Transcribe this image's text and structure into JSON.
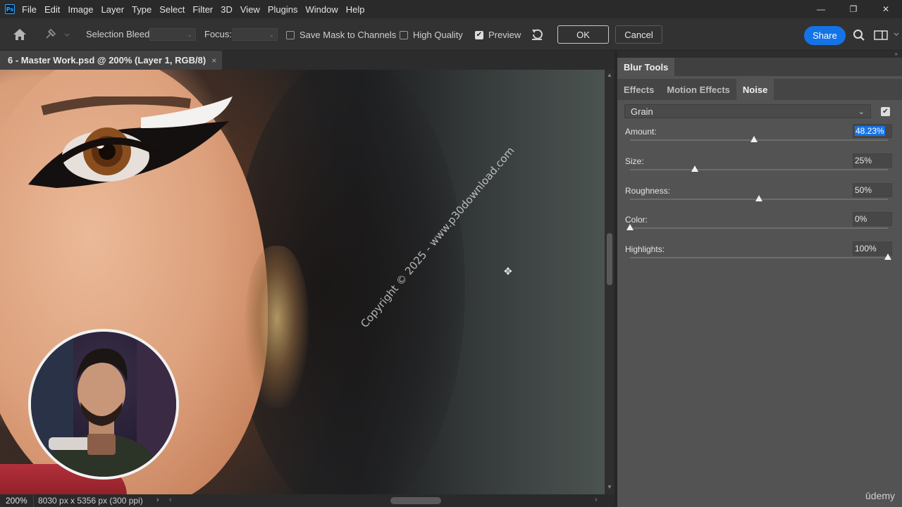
{
  "menubar": {
    "logo": "Ps",
    "items": [
      "File",
      "Edit",
      "Image",
      "Layer",
      "Type",
      "Select",
      "Filter",
      "3D",
      "View",
      "Plugins",
      "Window",
      "Help"
    ],
    "window_controls": [
      "—",
      "❐",
      "✕"
    ]
  },
  "options": {
    "selection_bleed_label": "Selection Bleed:",
    "focus_label": "Focus:",
    "save_mask_label": "Save Mask to Channels",
    "save_mask_checked": false,
    "high_quality_label": "High Quality",
    "high_quality_checked": false,
    "preview_label": "Preview",
    "preview_checked": true,
    "ok_label": "OK",
    "cancel_label": "Cancel",
    "share_label": "Share"
  },
  "document": {
    "tab_title": "6 - Master Work.psd @ 200% (Layer 1, RGB/8)",
    "close_glyph": "×",
    "watermark": "Copyright © 2025 - www.p30download.com"
  },
  "statusbar": {
    "zoom": "200%",
    "info": "8030 px x 5356 px (300 ppi)"
  },
  "panel": {
    "title": "Blur Tools",
    "tabs": [
      "Effects",
      "Motion Effects",
      "Noise"
    ],
    "active_tab": "Noise",
    "preset": "Grain",
    "preset_enabled": true,
    "params": [
      {
        "label": "Amount:",
        "value": "48.23%",
        "level": 0.48
      },
      {
        "label": "Size:",
        "value": "25%",
        "level": 0.25
      },
      {
        "label": "Roughness:",
        "value": "50%",
        "level": 0.5
      },
      {
        "label": "Color:",
        "value": "0%",
        "level": 0.0
      },
      {
        "label": "Highlights:",
        "value": "100%",
        "level": 1.0
      }
    ]
  },
  "branding": {
    "udemy": "ūdemy"
  },
  "colors": {
    "accent": "#1473e6",
    "panel_bg": "#535353"
  }
}
